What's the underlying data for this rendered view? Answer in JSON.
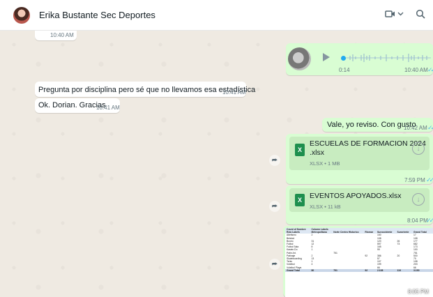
{
  "header": {
    "contact_name": "Erika Bustante Sec Deportes"
  },
  "messages": {
    "top_time": "10:40 AM",
    "voice": {
      "duration": "0:14",
      "time": "10:40 AM"
    },
    "m1": {
      "text": "Pregunta por disciplina pero sé que no llevamos esa estadística",
      "time": "10:41 AM"
    },
    "m2": {
      "text": "Ok. Dorian. Gracias",
      "time": "10:41 AM"
    },
    "m3": {
      "text": "Vale, yo reviso. Con gusto",
      "time": "10:42 AM"
    },
    "file1": {
      "name_line1": "ESCUELAS DE FORMACION 2024",
      "name_line2": ".xlsx",
      "meta": "XLSX • 1 MB",
      "time": "7:59 PM"
    },
    "file2": {
      "name": "EVENTOS APOYADOS.xlsx",
      "meta": "XLSX • 11 kB",
      "time": "8:04 PM"
    },
    "image": {
      "time": "8:05 PM"
    }
  },
  "sheet": {
    "header1": [
      "Count of Nombre",
      "Column Labels",
      "",
      "",
      "",
      "",
      "",
      ""
    ],
    "header2": [
      "Row Labels",
      "Metropolitana",
      "Norte Centro Historico",
      "Riomar",
      "Suroccidente",
      "Suroriente",
      "Grand Total",
      ""
    ],
    "rows": [
      [
        "Atletismo",
        "2",
        "",
        "",
        "150",
        "",
        "17",
        ""
      ],
      [
        "Beisbol",
        "",
        "",
        "",
        "108",
        "",
        "108",
        ""
      ],
      [
        "Boxeo",
        "31",
        "",
        "",
        "120",
        "26",
        "177",
        ""
      ],
      [
        "Futbol",
        "12",
        "",
        "",
        "597",
        "73",
        "682",
        ""
      ],
      [
        "Futbol Sala",
        "8",
        "",
        "",
        "165",
        "",
        "173",
        ""
      ],
      [
        "Karate-Do",
        "1",
        "",
        "",
        "99",
        "",
        "100",
        ""
      ],
      [
        "Patin Art.",
        "",
        "751",
        "",
        "",
        "",
        "751",
        ""
      ],
      [
        "Patinaje",
        "2",
        "",
        "92",
        "386",
        "20",
        "500",
        ""
      ],
      [
        "Skateboarding",
        "13",
        "",
        "",
        "57",
        "",
        "70",
        ""
      ],
      [
        "Tenis",
        "1",
        "",
        "",
        "107",
        "",
        "108",
        ""
      ],
      [
        "Voleibol",
        "4",
        "",
        "",
        "199",
        "",
        "203",
        ""
      ],
      [
        "Voleibol Playa",
        "",
        "",
        "",
        "66",
        "",
        "66",
        ""
      ]
    ],
    "total": [
      "Grand Total",
      "80",
      "751",
      "92",
      "2.108",
      "119",
      "3.150",
      ""
    ]
  }
}
